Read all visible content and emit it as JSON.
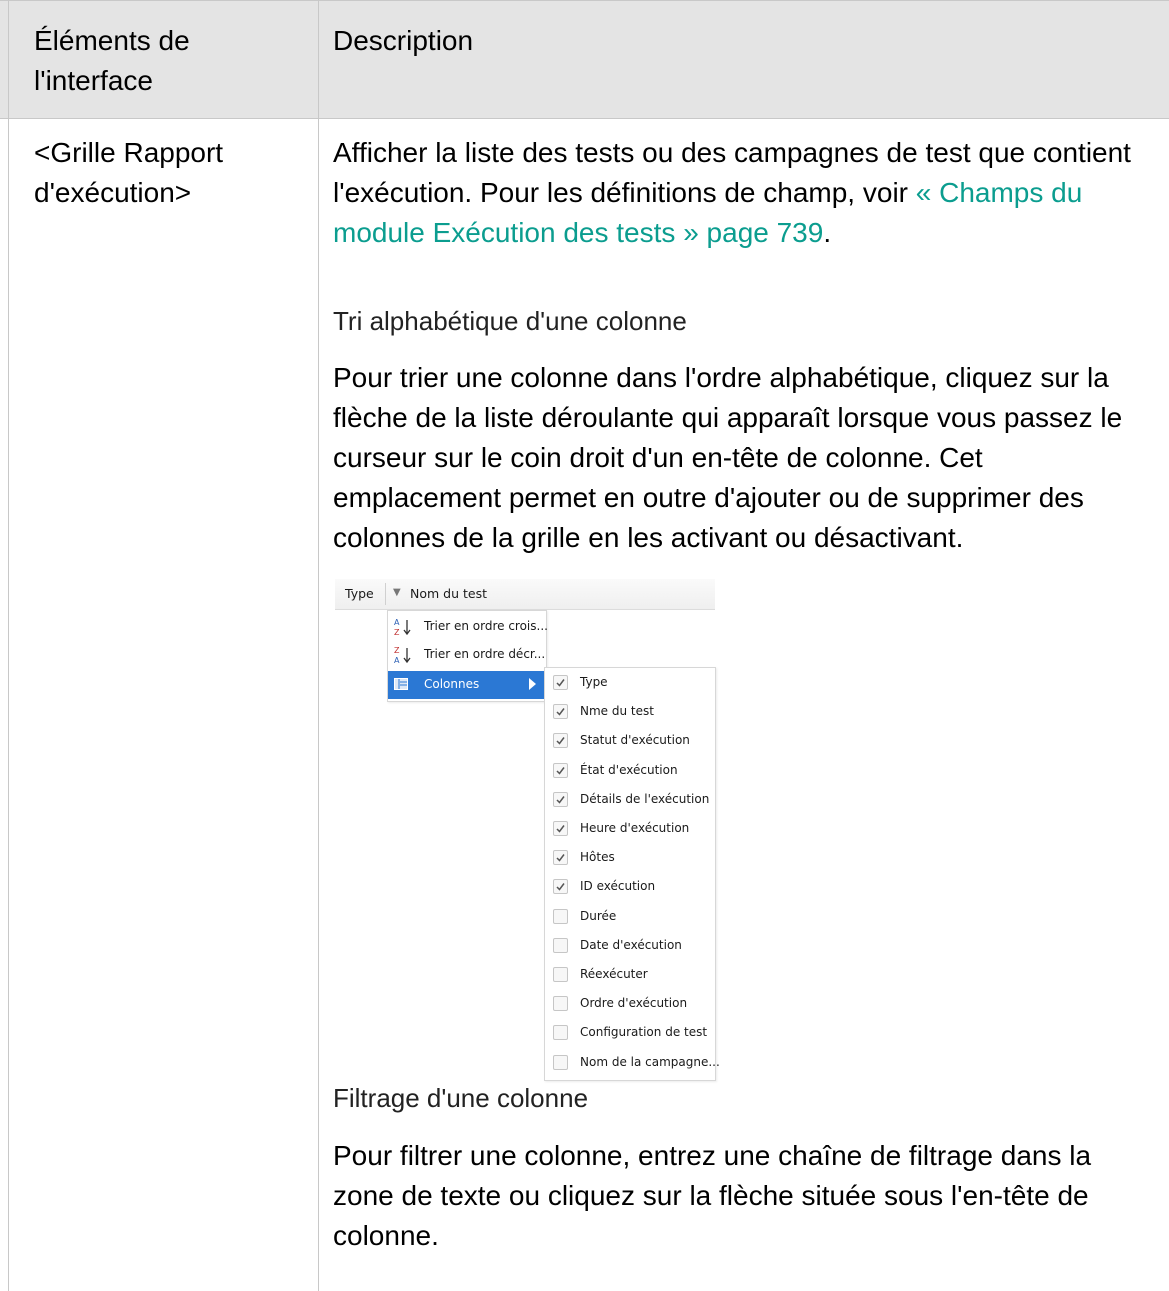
{
  "table": {
    "header": {
      "col1": "Éléments de l'interface",
      "col2": "Description"
    },
    "row": {
      "element": "<Grille Rapport d'exécution>",
      "intro_text": "Afficher la liste des tests ou des campagnes de test que contient l'exécution. Pour les définitions de champ, voir ",
      "intro_link": "« Champs du module Exécution des tests » page 739",
      "intro_end": ".",
      "section1_heading": "Tri alphabétique d'une colonne",
      "section1_text": "Pour trier une colonne dans l'ordre alphabétique, cliquez sur la flèche de la liste déroulante qui apparaît lorsque vous passez le curseur sur le coin droit d'un en-tête de colonne. Cet emplacement permet en outre d'ajouter ou de supprimer des colonnes de la grille en les activant ou désactivant.",
      "section2_heading": "Filtrage d'une colonne",
      "section2_text": "Pour filtrer une colonne, entrez une chaîne de filtrage dans la zone de texte ou cliquez sur la flèche située sous l'en-tête de colonne."
    }
  },
  "screenshot": {
    "grid_header": {
      "col_type": "Type",
      "col_name": "Nom du test"
    },
    "column_menu": {
      "items": [
        {
          "label": "Trier en ordre crois...",
          "icon": "sort-ascending-icon"
        },
        {
          "label": "Trier en ordre décr...",
          "icon": "sort-descending-icon"
        },
        {
          "label": "Colonnes",
          "icon": "columns-icon"
        }
      ]
    },
    "columns_submenu": {
      "items": [
        {
          "label": "Type",
          "checked": true
        },
        {
          "label": "Nme du test",
          "checked": true
        },
        {
          "label": "Statut d'exécution",
          "checked": true
        },
        {
          "label": "État d'exécution",
          "checked": true
        },
        {
          "label": "Détails de l'exécution",
          "checked": true
        },
        {
          "label": "Heure d'exécution",
          "checked": true
        },
        {
          "label": "Hôtes",
          "checked": true
        },
        {
          "label": "ID exécution",
          "checked": true
        },
        {
          "label": "Durée",
          "checked": false
        },
        {
          "label": "Date d'exécution",
          "checked": false
        },
        {
          "label": "Réexécuter",
          "checked": false
        },
        {
          "label": "Ordre d'exécution",
          "checked": false
        },
        {
          "label": "Configuration de test",
          "checked": false
        },
        {
          "label": "Nom de la campagne...",
          "checked": false
        }
      ]
    }
  },
  "colors": {
    "header_bg": "#e4e4e4",
    "border": "#c8c8c8",
    "link": "#0b9d8f",
    "menu_highlight": "#2b78d4"
  }
}
